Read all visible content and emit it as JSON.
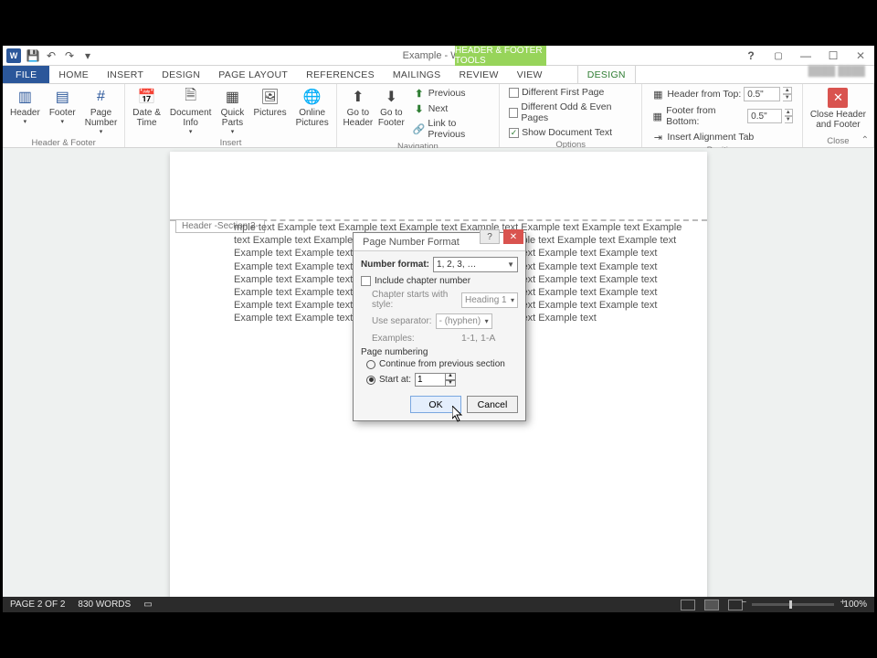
{
  "window": {
    "title": "Example - Word",
    "contextual_tools": "HEADER & FOOTER TOOLS"
  },
  "tabs": {
    "file": "FILE",
    "home": "HOME",
    "insert": "INSERT",
    "design1": "DESIGN",
    "page_layout": "PAGE LAYOUT",
    "references": "REFERENCES",
    "mailings": "MAILINGS",
    "review": "REVIEW",
    "view": "VIEW",
    "design2": "DESIGN"
  },
  "ribbon": {
    "header": "Header",
    "footer": "Footer",
    "page_number": "Page\nNumber",
    "group_hf": "Header & Footer",
    "date_time": "Date &\nTime",
    "doc_info": "Document\nInfo",
    "quick_parts": "Quick\nParts",
    "pictures": "Pictures",
    "online_pictures": "Online\nPictures",
    "group_insert": "Insert",
    "goto_header": "Go to\nHeader",
    "goto_footer": "Go to\nFooter",
    "previous": "Previous",
    "next": "Next",
    "link_prev": "Link to Previous",
    "group_nav": "Navigation",
    "diff_first": "Different First Page",
    "diff_oe": "Different Odd & Even Pages",
    "show_doc": "Show Document Text",
    "group_options": "Options",
    "hdr_from_top": "Header from Top:",
    "ftr_from_bottom": "Footer from Bottom:",
    "insert_align_tab": "Insert Alignment Tab",
    "pos_val": "0.5\"",
    "group_position": "Position",
    "close_hf": "Close Header\nand Footer",
    "group_close": "Close"
  },
  "page": {
    "header_tab": "Header -Section 2-",
    "body": "mple text Example text Example text Example text Example text Example text Example text Example text Example text Example text Example text Example text Example text Example text Example text Example text Example text Example text Example text Example text Example text Example text Example text Example text Example text Example text Example text Example text Example text Example text Example text Example text Example text Example text Example text Example text Example text Example text Example text Example text Example text Example text Example text Example text Example text Example text Example text Example text Example text Example text Example text Example text Example text Example text Example text Example text"
  },
  "dialog": {
    "title": "Page Number Format",
    "number_format_label": "Number format:",
    "number_format_value": "1, 2, 3, …",
    "include_chapter": "Include chapter number",
    "chapter_starts": "Chapter starts with style:",
    "chapter_style_value": "Heading 1",
    "use_separator": "Use separator:",
    "separator_value": "- (hyphen)",
    "examples_label": "Examples:",
    "examples_value": "1-1, 1-A",
    "page_numbering": "Page numbering",
    "continue": "Continue from previous section",
    "start_at": "Start at:",
    "start_value": "1",
    "ok": "OK",
    "cancel": "Cancel"
  },
  "status": {
    "page": "PAGE 2 OF 2",
    "words": "830 WORDS",
    "zoom": "100%"
  }
}
